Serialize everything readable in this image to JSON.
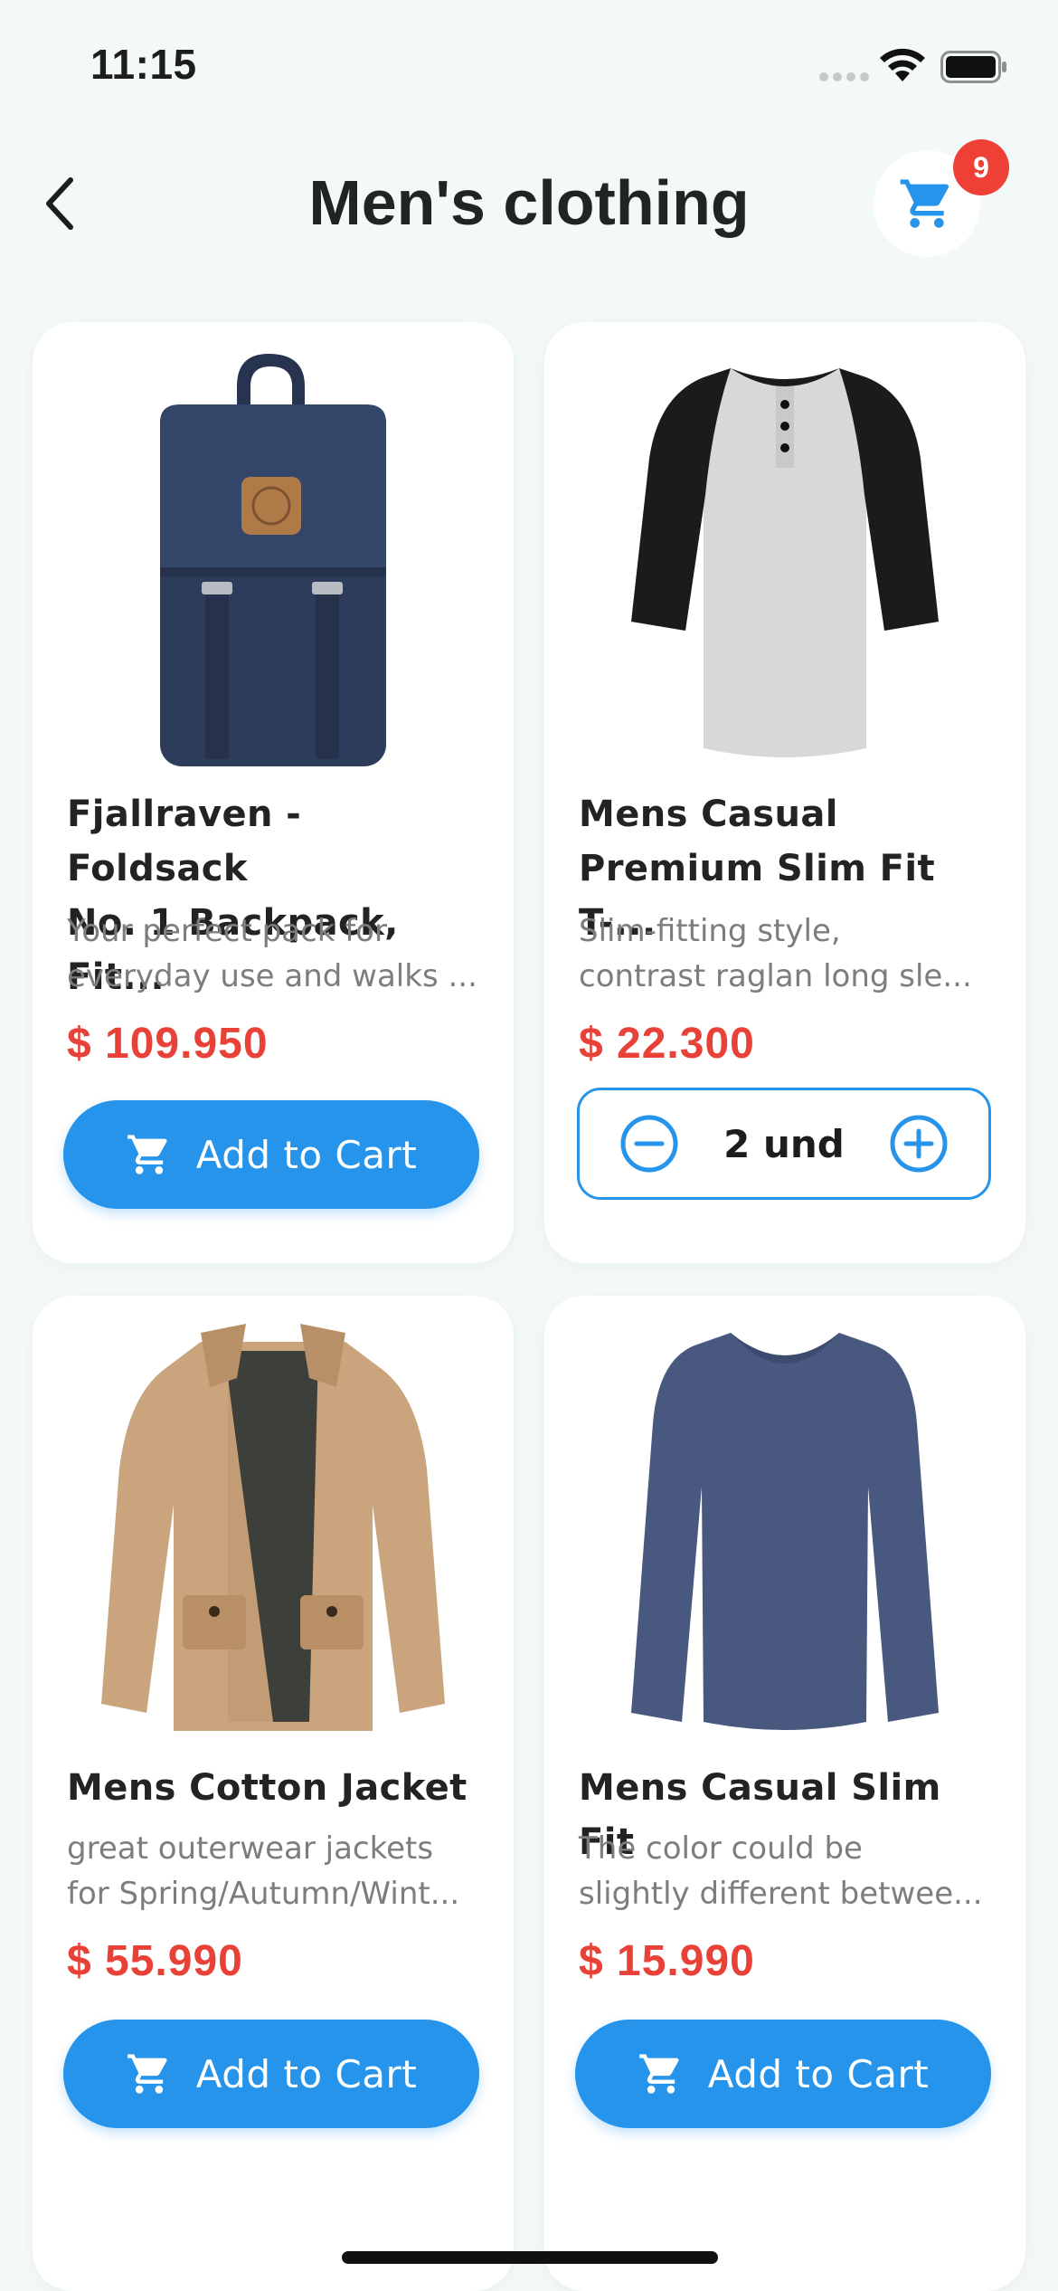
{
  "status_bar": {
    "time": "11:15"
  },
  "header": {
    "title": "Men's clothing",
    "cart_count": "9"
  },
  "products": [
    {
      "title_line1": "Fjallraven - Foldsack",
      "title_line2": "No. 1 Backpack, Fit...",
      "desc_line1": "Your perfect pack for",
      "desc_line2": "everyday use and walks ...",
      "price": "$ 109.950",
      "button_label": "Add to Cart"
    },
    {
      "title_line1": "Mens Casual",
      "title_line2": "Premium Slim Fit T-...",
      "desc_line1": "Slim-fitting style,",
      "desc_line2": "contrast raglan long sle...",
      "price": "$ 22.300",
      "quantity": "2 und"
    },
    {
      "title_line1": "Mens Cotton Jacket",
      "desc_line1": "great outerwear jackets",
      "desc_line2": "for Spring/Autumn/Wint...",
      "price": "$ 55.990",
      "button_label": "Add to Cart"
    },
    {
      "title_line1": "Mens Casual Slim Fit",
      "desc_line1": "The color could be",
      "desc_line2": "slightly different betwee...",
      "price": "$ 15.990",
      "button_label": "Add to Cart"
    }
  ],
  "colors": {
    "accent": "#2594ea",
    "price": "#e84137",
    "badge": "#ee4036",
    "background": "#f3f8f8"
  },
  "icons": [
    "chevron-left-icon",
    "cart-icon",
    "minus-circle-icon",
    "plus-circle-icon",
    "wifi-icon",
    "battery-icon"
  ]
}
